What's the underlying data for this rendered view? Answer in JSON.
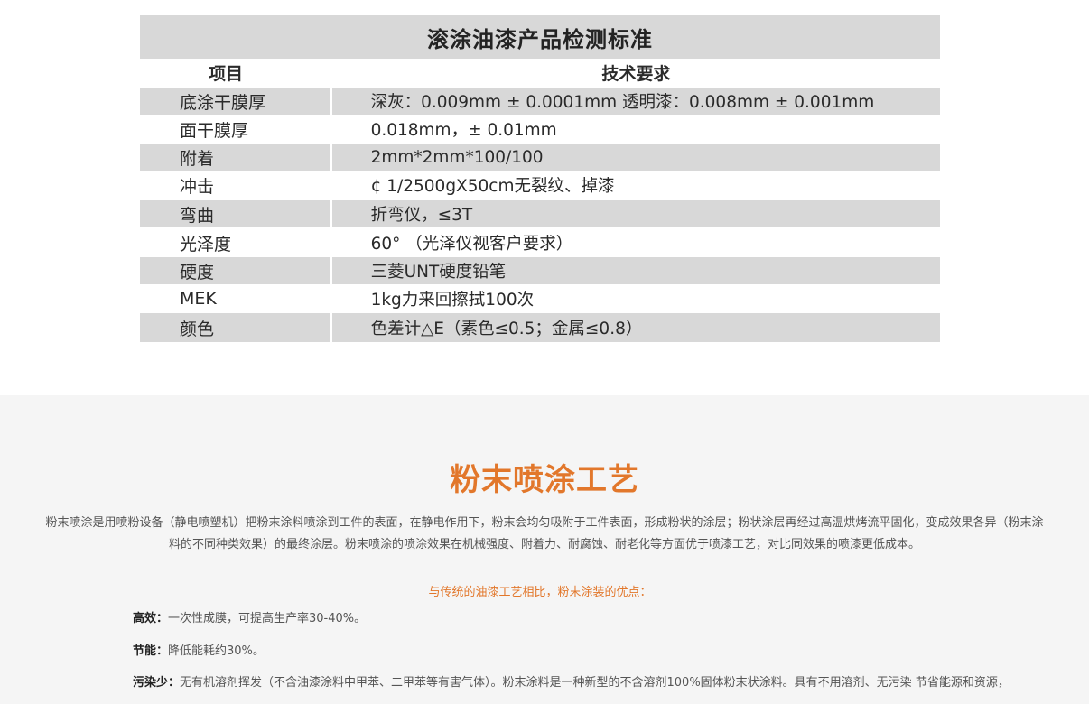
{
  "spec_table": {
    "title": "滚涂油漆产品检测标准",
    "header": {
      "item": "项目",
      "requirement": "技术要求"
    },
    "rows": [
      {
        "item": "底涂干膜厚",
        "requirement": "深灰：0.009mm ± 0.0001mm 透明漆：0.008mm ± 0.001mm"
      },
      {
        "item": "面干膜厚",
        "requirement": "0.018mm，± 0.01mm"
      },
      {
        "item": "附着",
        "requirement": "2mm*2mm*100/100"
      },
      {
        "item": "冲击",
        "requirement": "¢ 1/2500gX50cm无裂纹、掉漆"
      },
      {
        "item": "弯曲",
        "requirement": "折弯仪，≤3T"
      },
      {
        "item": "光泽度",
        "requirement": "60° （光泽仪视客户要求）"
      },
      {
        "item": "硬度",
        "requirement": "三菱UNT硬度铅笔"
      },
      {
        "item": "MEK",
        "requirement": "1kg力来回擦拭100次"
      },
      {
        "item": "颜色",
        "requirement": "色差计△E（素色≤0.5；金属≤0.8）"
      }
    ]
  },
  "powder_section": {
    "title": "粉末喷涂工艺",
    "intro_line1": "粉末喷涂是用喷粉设备（静电喷塑机）把粉末涂料喷涂到工件的表面，在静电作用下，粉末会均匀吸附于工件表面，形成粉状的涂层；粉状涂层再经过高温烘烤流平固化，变成效果各异（粉末涂",
    "intro_line2": "料的不同种类效果）的最终涂层。粉末喷涂的喷涂效果在机械强度、附着力、耐腐蚀、耐老化等方面优于喷漆工艺，对比同效果的喷漆更低成本。",
    "advantages_heading": "与传统的油漆工艺相比，粉末涂装的优点：",
    "advantages": [
      {
        "label": "高效：",
        "text": "一次性成膜，可提高生产率30-40%。"
      },
      {
        "label": "节能：",
        "text": "降低能耗约30%。"
      },
      {
        "label": "污染少：",
        "text": "无有机溶剂挥发（不含油漆涂料中甲苯、二甲苯等有害气体）。粉末涂料是一种新型的不含溶剂100%固体粉末状涂料。具有不用溶剂、无污染 节省能源和资源，"
      }
    ]
  },
  "colors": {
    "accent_orange": "#e2772b",
    "table_gray": "#d8d8d8",
    "section_bg": "#f5f5f5"
  }
}
